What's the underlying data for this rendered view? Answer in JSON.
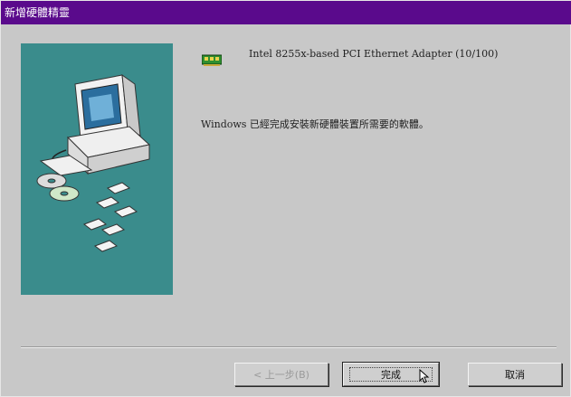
{
  "window": {
    "title": "新增硬體精靈"
  },
  "device": {
    "name": "Intel 8255x-based PCI Ethernet Adapter (10/100)",
    "icon": "network-card-icon"
  },
  "message": "Windows 已經完成安裝新硬體裝置所需要的軟體。",
  "buttons": {
    "back_label": "< 上一步(B)",
    "finish_label": "完成",
    "cancel_label": "取消"
  },
  "colors": {
    "titlebar": "#5a0a8c",
    "art_background": "#3a8c8c",
    "dialog_background": "#c8c8c8"
  }
}
